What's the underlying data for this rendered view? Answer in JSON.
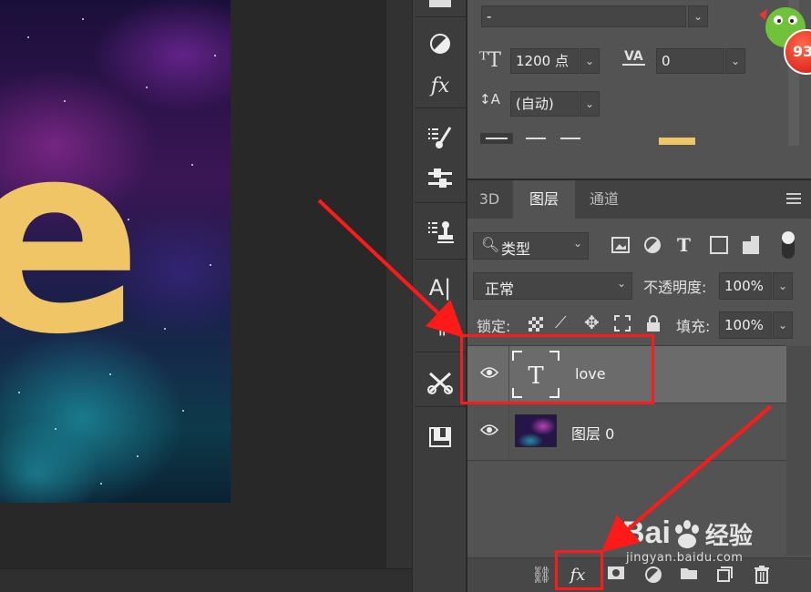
{
  "canvas": {
    "letter": "e"
  },
  "tools": [
    {
      "name": "swatches-icon",
      "glyph": "▤"
    },
    {
      "name": "adjustments-icon",
      "glyph": "◐"
    },
    {
      "name": "fx-icon",
      "glyph": "fx"
    },
    {
      "name": "brush-settings-icon",
      "glyph": "⋮✎"
    },
    {
      "name": "sliders-icon",
      "glyph": "⚌"
    },
    {
      "name": "clone-stamp-icon",
      "glyph": "⋮♟"
    },
    {
      "name": "character-icon",
      "glyph": "A|"
    },
    {
      "name": "paragraph-icon",
      "glyph": "¶"
    },
    {
      "name": "tool-presets-icon",
      "glyph": "✂"
    },
    {
      "name": "history-icon",
      "glyph": "▣"
    }
  ],
  "character": {
    "font_style": "-",
    "font_size": "1200 点",
    "tracking": "0",
    "leading": "(自动)",
    "color": "#efc565"
  },
  "layers_panel": {
    "tabs": [
      "3D",
      "图层",
      "通道"
    ],
    "active_tab": "图层",
    "filter_kind": "类型",
    "blend_mode": "正常",
    "opacity_label": "不透明度:",
    "opacity_value": "100%",
    "lock_label": "锁定:",
    "fill_label": "填充:",
    "fill_value": "100%",
    "layers": [
      {
        "name": "love",
        "type": "text",
        "selected": true
      },
      {
        "name": "图层 0",
        "type": "image",
        "selected": false
      }
    ]
  },
  "footer": {
    "fx_label": "fx"
  },
  "watermark": {
    "brand": "Bai",
    "brand2": "经验",
    "url": "jingyan.baidu.com"
  },
  "badge": {
    "text": "93"
  },
  "annotation_color": "#ff1a1a"
}
